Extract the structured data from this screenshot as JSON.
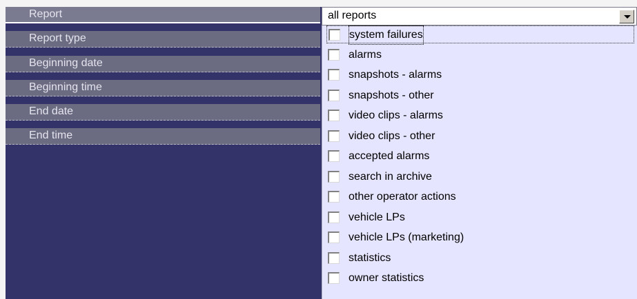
{
  "properties": {
    "rows": [
      {
        "label": "Report"
      },
      {
        "label": "Report type"
      },
      {
        "label": "Beginning date"
      },
      {
        "label": "Beginning time"
      },
      {
        "label": "End date"
      },
      {
        "label": "End time"
      }
    ]
  },
  "report_combo": {
    "selected_value": "all reports",
    "options": [
      {
        "label": "system failures",
        "checked": false,
        "focused": true
      },
      {
        "label": "alarms",
        "checked": false
      },
      {
        "label": "snapshots - alarms",
        "checked": false
      },
      {
        "label": "snapshots - other",
        "checked": false
      },
      {
        "label": "video clips - alarms",
        "checked": false
      },
      {
        "label": "video clips - other",
        "checked": false
      },
      {
        "label": "accepted alarms",
        "checked": false
      },
      {
        "label": "search in archive",
        "checked": false
      },
      {
        "label": "other operator actions",
        "checked": false
      },
      {
        "label": "vehicle LPs",
        "checked": false
      },
      {
        "label": "vehicle LPs (marketing)",
        "checked": false
      },
      {
        "label": "statistics",
        "checked": false
      },
      {
        "label": "owner statistics",
        "checked": false
      }
    ]
  },
  "colors": {
    "panel_bg": "#33336a",
    "row_bg": "#6b6b82",
    "list_bg": "#e6e5ff"
  }
}
